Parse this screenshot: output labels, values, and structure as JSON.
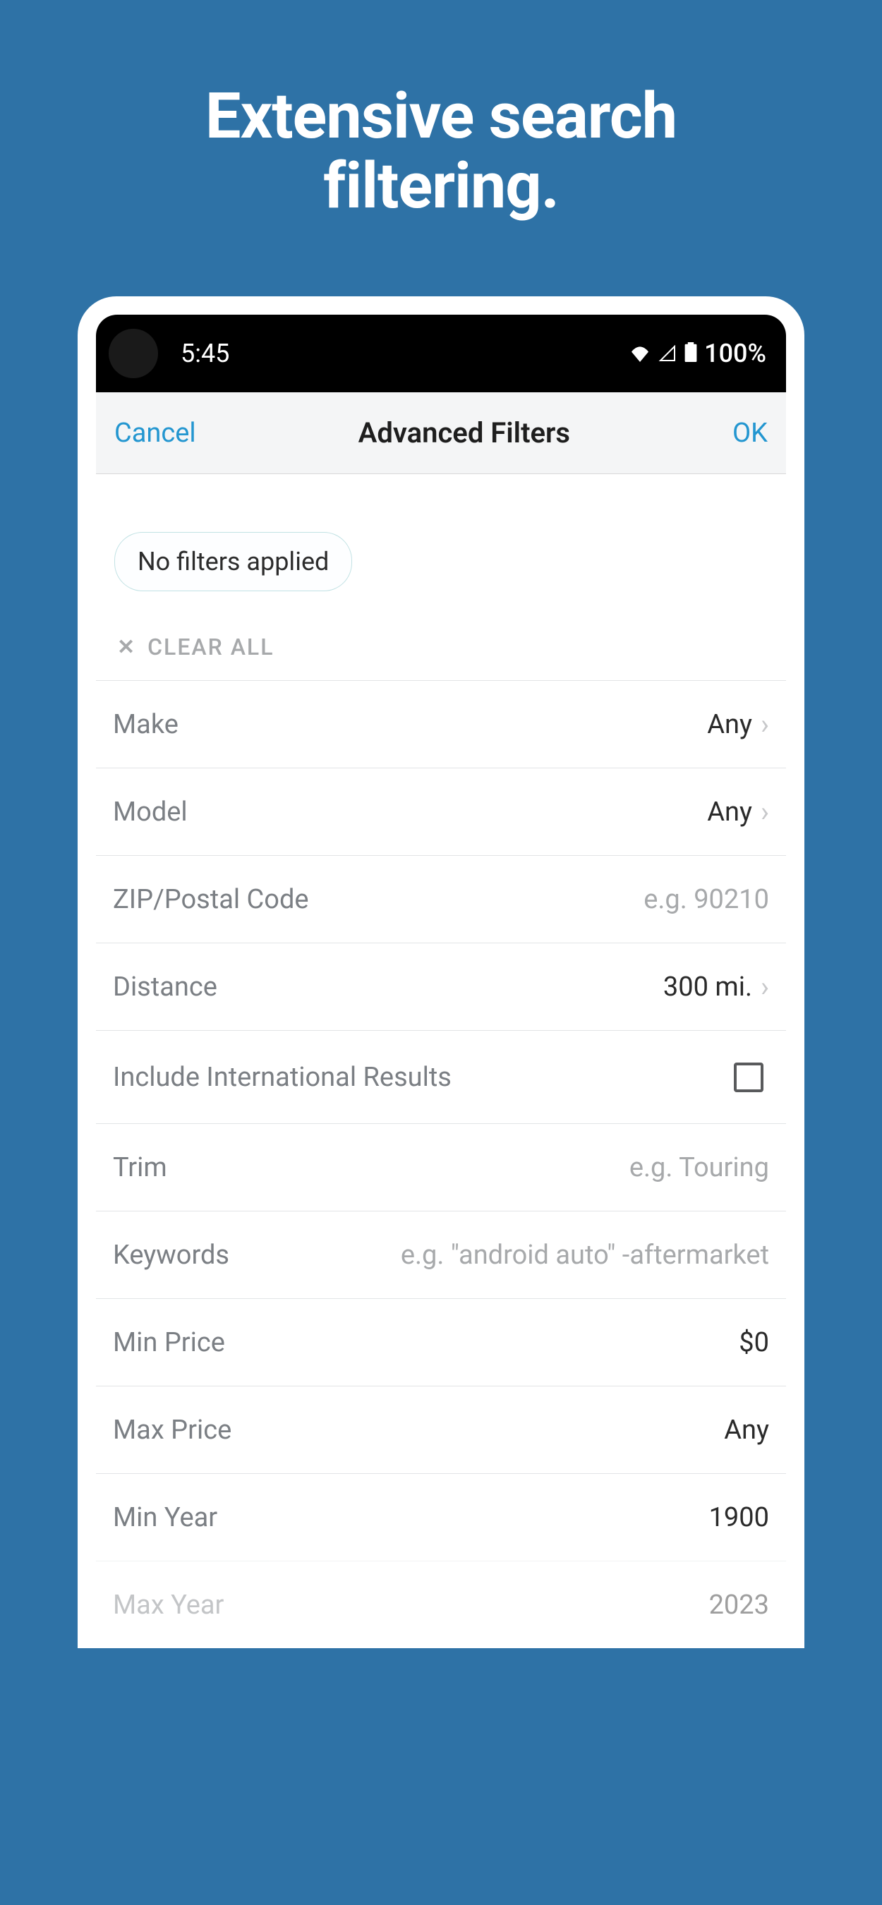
{
  "hero": {
    "line1": "Extensive search",
    "line2": "filtering."
  },
  "status": {
    "time": "5:45",
    "battery": "100%"
  },
  "nav": {
    "cancel": "Cancel",
    "title": "Advanced Filters",
    "ok": "OK"
  },
  "chip": {
    "label": "No filters applied"
  },
  "clear": {
    "label": "CLEAR ALL"
  },
  "filters": {
    "make": {
      "label": "Make",
      "value": "Any"
    },
    "model": {
      "label": "Model",
      "value": "Any"
    },
    "zip": {
      "label": "ZIP/Postal Code",
      "placeholder": "e.g. 90210"
    },
    "distance": {
      "label": "Distance",
      "value": "300 mi."
    },
    "intl": {
      "label": "Include International Results"
    },
    "trim": {
      "label": "Trim",
      "placeholder": "e.g. Touring"
    },
    "keywords": {
      "label": "Keywords",
      "placeholder": "e.g. \"android auto\" -aftermarket"
    },
    "minprice": {
      "label": "Min Price",
      "value": "$0"
    },
    "maxprice": {
      "label": "Max Price",
      "value": "Any"
    },
    "minyear": {
      "label": "Min Year",
      "value": "1900"
    },
    "maxyear": {
      "label": "Max Year",
      "value": "2023"
    }
  }
}
